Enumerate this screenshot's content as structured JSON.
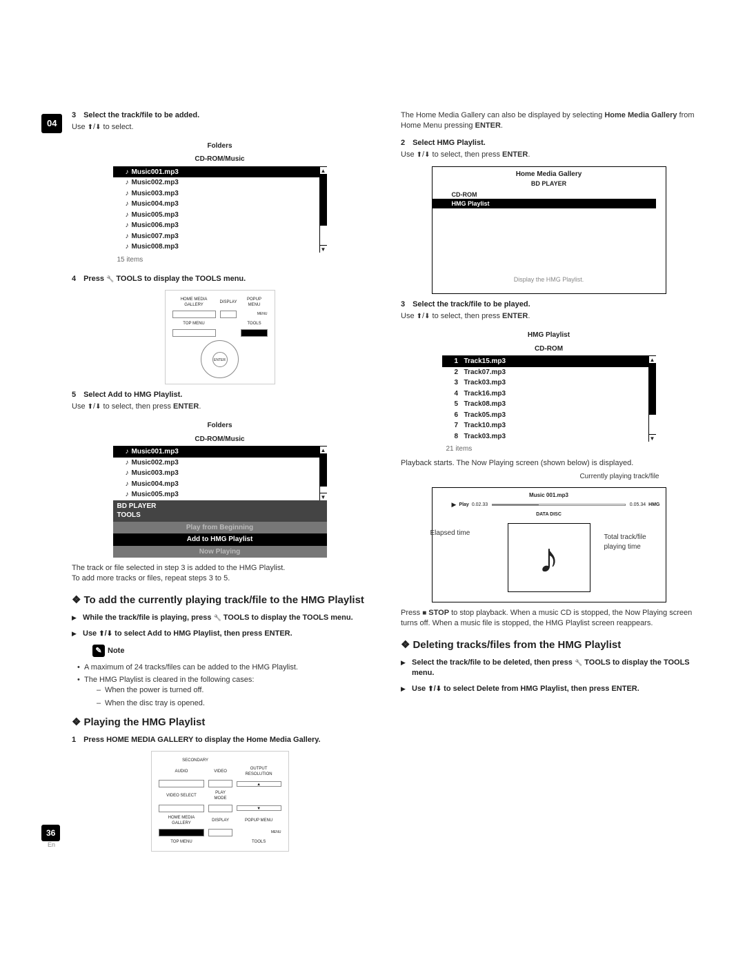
{
  "chapter": "04",
  "page": "36",
  "lang": "En",
  "left": {
    "s3": {
      "num": "3",
      "title": "Select the track/file to be added.",
      "sub_pre": "Use ",
      "sub_post": " to select."
    },
    "listbox1": {
      "head1": "Folders",
      "head2": "CD-ROM/Music",
      "rows": [
        "Music001.mp3",
        "Music002.mp3",
        "Music003.mp3",
        "Music004.mp3",
        "Music005.mp3",
        "Music006.mp3",
        "Music007.mp3",
        "Music008.mp3"
      ],
      "footer": "15 items"
    },
    "s4": {
      "num": "4",
      "title_pre": "Press ",
      "title_post": " TOOLS to display the TOOLS menu."
    },
    "remote1": {
      "r1": [
        "HOME MEDIA GALLERY",
        "DISPLAY",
        "POPUP MENU"
      ],
      "menu": "MENU",
      "r2l": "TOP MENU",
      "r2r": "TOOLS",
      "enter": "ENTER"
    },
    "s5": {
      "num": "5",
      "title": "Select Add to HMG Playlist.",
      "sub_pre": "Use ",
      "sub_mid": " to select, then press ",
      "enter": "ENTER",
      "sub_post": "."
    },
    "listbox2": {
      "head1": "Folders",
      "head2": "CD-ROM/Music",
      "rows": [
        "Music001.mp3",
        "Music002.mp3",
        "Music003.mp3",
        "Music004.mp3",
        "Music005.mp3"
      ],
      "tp_head1": "BD PLAYER",
      "tp_head2": "TOOLS",
      "opt1": "Play from Beginning",
      "opt2": "Add to HMG Playlist",
      "opt3": "Now Playing"
    },
    "after5a": "The track or file selected in step 3 is added to the HMG Playlist.",
    "after5b": "To add more tracks or files, repeat steps 3 to 5.",
    "h_add": "To add the currently playing track/file to the HMG Playlist",
    "b1_pre": "While the track/file is playing, press ",
    "b1_post": " TOOLS to display the TOOLS menu.",
    "b2_pre": "Use ",
    "b2_post": " to select Add to HMG Playlist, then press ENTER.",
    "note": "Note",
    "n1": "A maximum of 24 tracks/files can be added to the HMG Playlist.",
    "n2": "The HMG Playlist is cleared in the following cases:",
    "n2a": "When the power is turned off.",
    "n2b": "When the disc tray is opened.",
    "h_play": "Playing the HMG Playlist",
    "p1": {
      "num": "1",
      "title": "Press HOME MEDIA GALLERY to display the Home Media Gallery."
    },
    "remote2": {
      "r0": [
        "SECONDARY",
        ""
      ],
      "r1": [
        "AUDIO",
        "VIDEO",
        "OUTPUT RESOLUTION"
      ],
      "r2": [
        "VIDEO SELECT",
        "PLAY MODE",
        ""
      ],
      "r3": [
        "HOME MEDIA GALLERY",
        "DISPLAY",
        "POPUP MENU"
      ],
      "menu": "MENU",
      "r4": [
        "TOP MENU",
        "",
        "TOOLS"
      ]
    }
  },
  "right": {
    "intro_pre": "The Home Media Gallery can also be displayed by selecting ",
    "intro_b1": "Home Media Gallery",
    "intro_mid": " from Home Menu pressing ",
    "intro_b2": "ENTER",
    "intro_post": ".",
    "s2": {
      "num": "2",
      "title": "Select HMG Playlist.",
      "sub_pre": "Use ",
      "sub_mid": " to select, then press ",
      "enter": "ENTER",
      "sub_post": "."
    },
    "big": {
      "head": "Home Media Gallery",
      "sub": "BD PLAYER",
      "cd": "CD-ROM",
      "hmg": "HMG Playlist",
      "disp": "Display the HMG Playlist."
    },
    "s3": {
      "num": "3",
      "title": "Select the track/file to be played.",
      "sub_pre": "Use ",
      "sub_mid": " to select, then press ",
      "enter": "ENTER",
      "sub_post": "."
    },
    "listbox3": {
      "head1": "HMG Playlist",
      "head2": "CD-ROM",
      "rows": [
        {
          "n": "1",
          "t": "Track15.mp3"
        },
        {
          "n": "2",
          "t": "Track07.mp3"
        },
        {
          "n": "3",
          "t": "Track03.mp3"
        },
        {
          "n": "4",
          "t": "Track16.mp3"
        },
        {
          "n": "5",
          "t": "Track08.mp3"
        },
        {
          "n": "6",
          "t": "Track05.mp3"
        },
        {
          "n": "7",
          "t": "Track10.mp3"
        },
        {
          "n": "8",
          "t": "Track03.mp3"
        }
      ],
      "footer": "21 items"
    },
    "after3": "Playback starts. The Now Playing screen (shown below) is displayed.",
    "np": {
      "title": "Music 001.mp3",
      "play": "Play",
      "elapsed": "0.02.33",
      "total": "0.05.34",
      "hmg": "HMG",
      "data": "DATA DISC",
      "co1": "Currently playing track/file",
      "co2": "Total track/file playing time",
      "co3": "Elapsed time"
    },
    "stop_pre": "Press ",
    "stop_b": "STOP",
    "stop_post": " to stop playback. When a music CD is stopped, the Now Playing screen turns off. When a music file is stopped, the HMG Playlist screen reappears.",
    "h_del": "Deleting tracks/files from the HMG Playlist",
    "d1_pre": "Select the track/file to be deleted, then press ",
    "d1_post": " TOOLS to display the TOOLS menu.",
    "d2_pre": "Use ",
    "d2_post": " to select Delete from HMG Playlist, then press ENTER."
  }
}
